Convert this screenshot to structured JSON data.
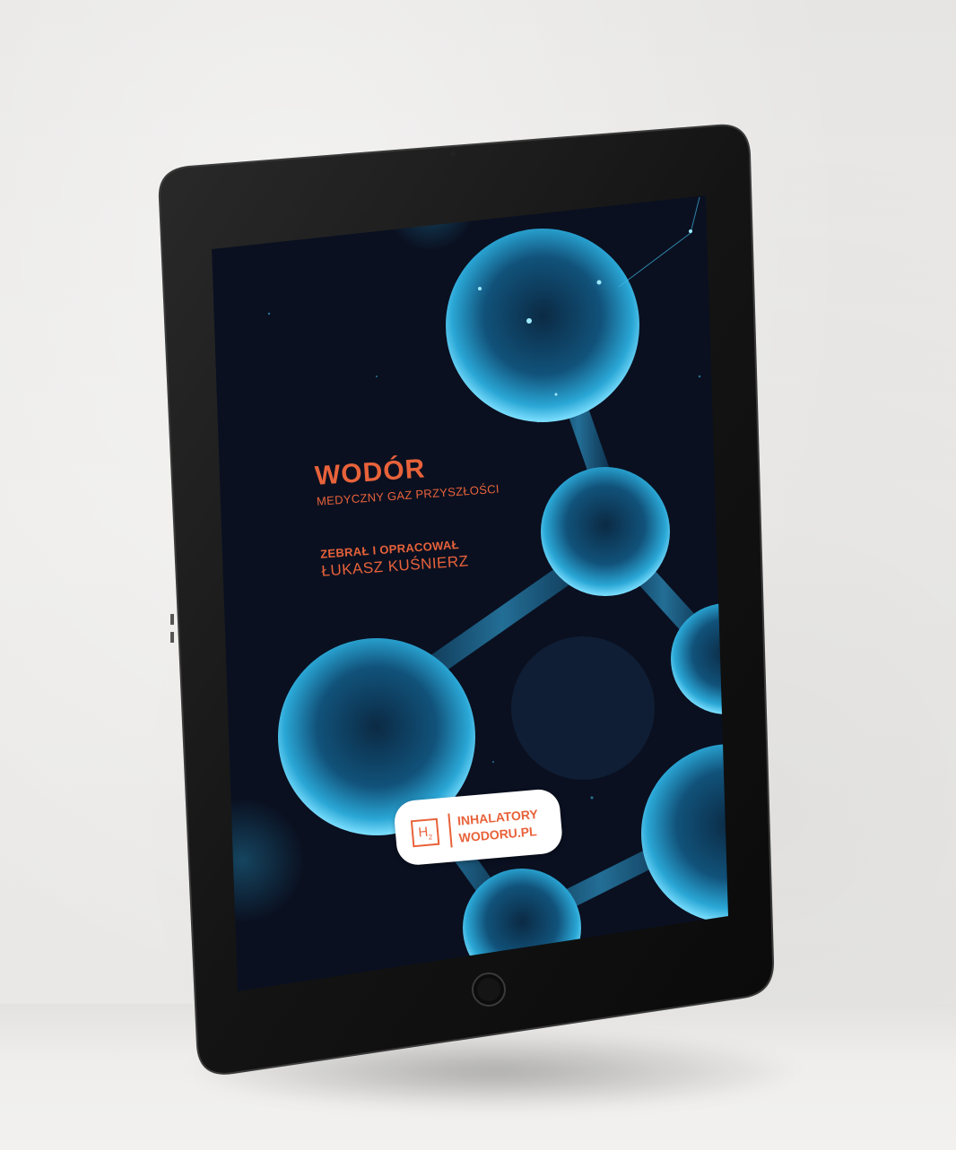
{
  "cover": {
    "title": "WODÓR",
    "subtitle": "MEDYCZNY GAZ PRZYSZŁOŚCI",
    "credit_label": "ZEBRAŁ I OPRACOWAŁ",
    "credit_name": "ŁUKASZ KUŚNIERZ"
  },
  "logo": {
    "symbol": "H",
    "symbol_sub": "2",
    "line1": "INHALATORY",
    "line2": "WODORU.PL"
  },
  "colors": {
    "accent": "#e8623a",
    "screen_bg": "#0a1020",
    "molecule": "#2aa7d6",
    "frame": "#151515"
  }
}
